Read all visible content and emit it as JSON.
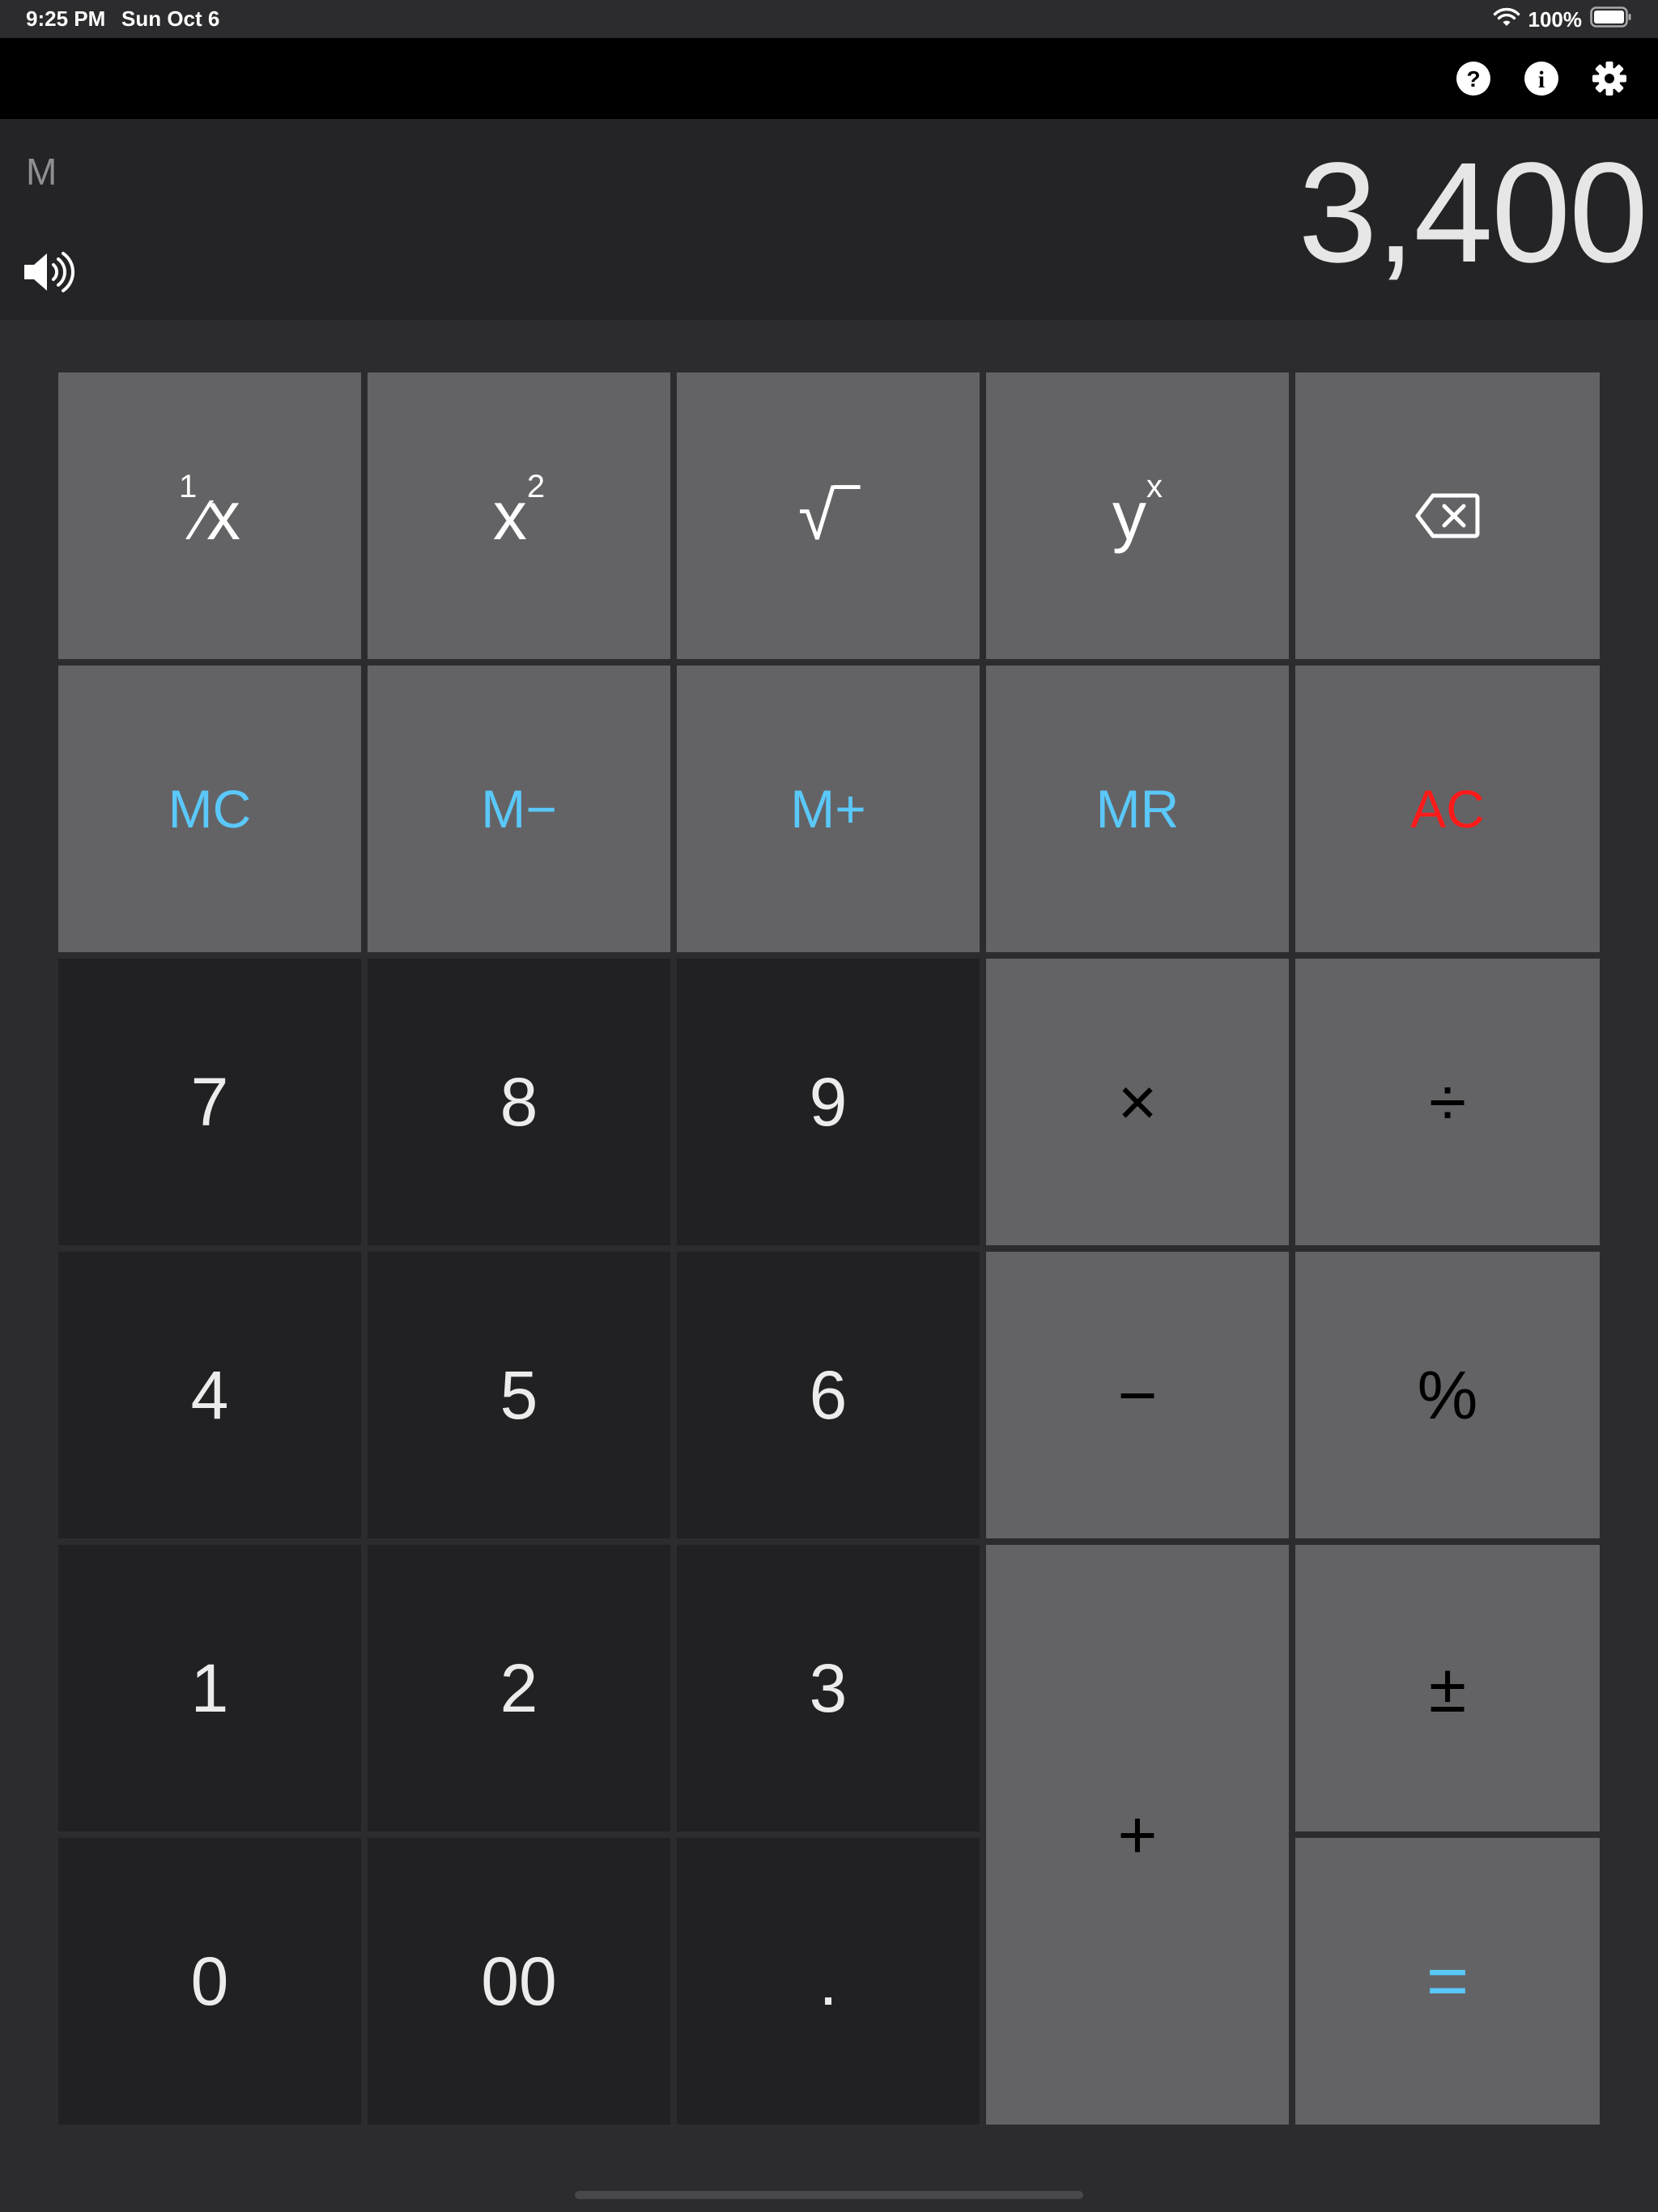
{
  "status_bar": {
    "time": "9:25 PM",
    "date": "Sun Oct 6",
    "battery": "100%"
  },
  "toolbar": {
    "icons": [
      "help-icon",
      "info-icon",
      "settings-icon"
    ]
  },
  "display": {
    "memory_indicator": "M",
    "value": "3,400"
  },
  "keys": {
    "reciprocal": {
      "top": "1",
      "bottom": "x"
    },
    "square": {
      "base": "x",
      "exp": "2"
    },
    "sqrt": "√‾",
    "power": {
      "base": "y",
      "exp": "x"
    },
    "mc": "MC",
    "m_minus": "M−",
    "m_plus": "M+",
    "mr": "MR",
    "ac": "AC",
    "seven": "7",
    "eight": "8",
    "nine": "9",
    "multiply": "×",
    "divide": "÷",
    "four": "4",
    "five": "5",
    "six": "6",
    "minus": "−",
    "percent": "%",
    "one": "1",
    "two": "2",
    "three": "3",
    "plus": "+",
    "plus_minus": "±",
    "zero": "0",
    "double_zero": "00",
    "decimal": ".",
    "equals": "="
  },
  "colors": {
    "memory_keys": "#5ac8fa",
    "clear_key": "#ff1a1a",
    "function_key_bg": "#636366",
    "number_key_bg": "#212123"
  }
}
